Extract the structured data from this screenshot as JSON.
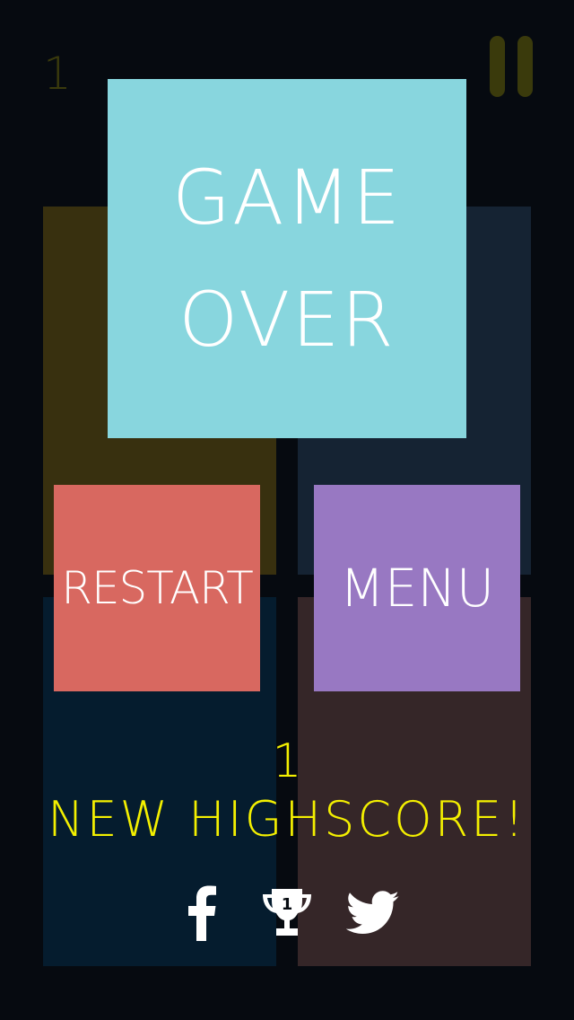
{
  "hud": {
    "score": "1"
  },
  "game_over": {
    "line1": "GAME",
    "line2": "OVER"
  },
  "buttons": {
    "restart_label": "RESTART",
    "menu_label": "MENU"
  },
  "result": {
    "score": "1",
    "highscore_label": "NEW HIGHSCORE!"
  },
  "leaderboard_icon_digit": "1",
  "icons": [
    "pause-icon",
    "facebook-icon",
    "trophy-icon",
    "twitter-icon"
  ],
  "colors": {
    "background": "#060a10",
    "hud": "#3a3a0c",
    "tile_top_left": "#38300f",
    "tile_top_right": "#152333",
    "tile_bottom_left": "#051c2e",
    "tile_bottom_right": "#352628",
    "game_over_panel": "#88d6de",
    "restart_button": "#d86860",
    "menu_button": "#9878c2",
    "highscore_text": "#f4f000"
  }
}
